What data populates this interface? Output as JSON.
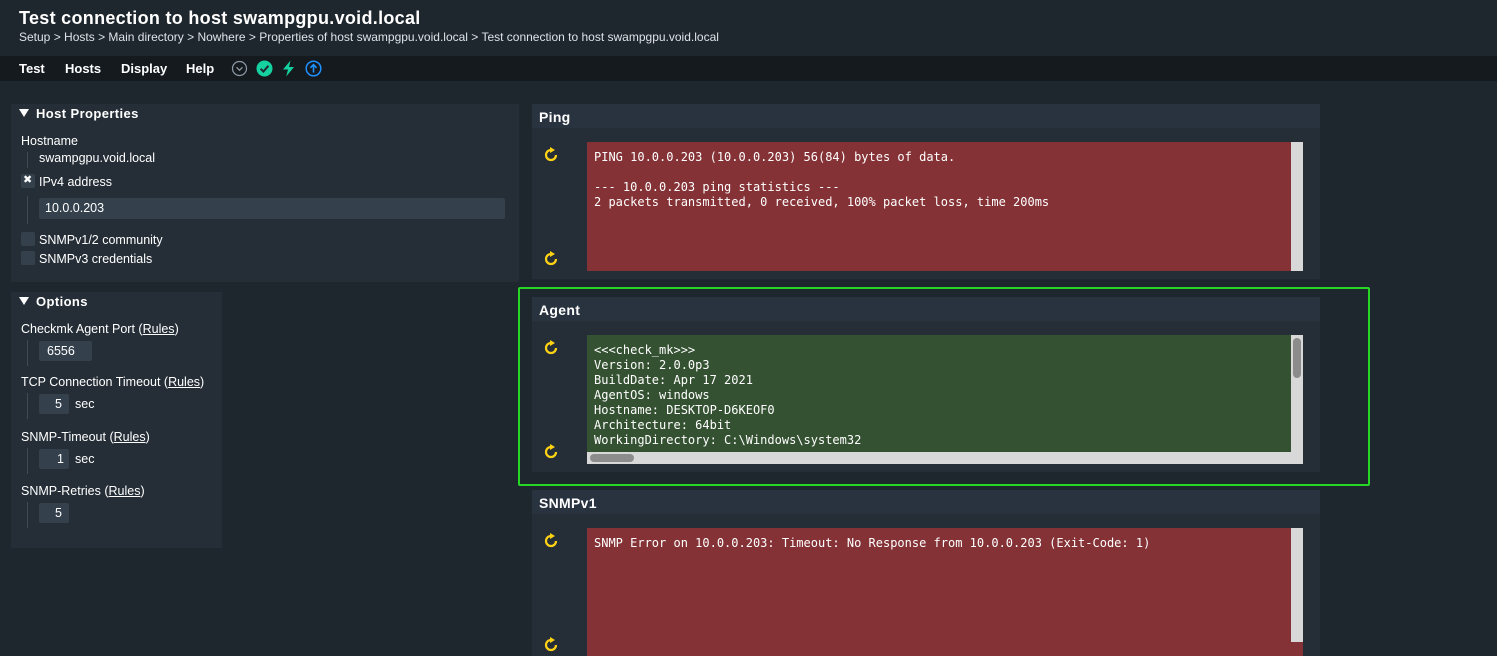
{
  "page": {
    "title": "Test connection to host swampgpu.void.local",
    "breadcrumb": [
      "Setup",
      "Hosts",
      "Main directory",
      "Nowhere",
      "Properties of host swampgpu.void.local",
      "Test connection to host swampgpu.void.local"
    ],
    "breadcrumb_sep": " > "
  },
  "menu": {
    "items": [
      "Test",
      "Hosts",
      "Display",
      "Help"
    ],
    "icons": [
      "chevron-down-icon",
      "check-circle-icon",
      "lightning-icon",
      "upload-icon"
    ]
  },
  "host_properties": {
    "title": "Host Properties",
    "hostname_label": "Hostname",
    "hostname_value": "swampgpu.void.local",
    "ipv4_label": "IPv4 address",
    "ipv4_checked": true,
    "ipv4_value": "10.0.0.203",
    "snmp_community_label": "SNMPv1/2 community",
    "snmp_v3_label": "SNMPv3 credentials"
  },
  "options": {
    "title": "Options",
    "rules_link": "Rules",
    "agent_port_label": "Checkmk Agent Port",
    "agent_port_value": "6556",
    "tcp_timeout_label": "TCP Connection Timeout",
    "tcp_timeout_value": "5",
    "snmp_timeout_label": "SNMP-Timeout",
    "snmp_timeout_value": "1",
    "snmp_retries_label": "SNMP-Retries",
    "snmp_retries_value": "5",
    "unit_sec": "sec"
  },
  "tests": {
    "ping": {
      "title": "Ping",
      "status": "error",
      "output": "PING 10.0.0.203 (10.0.0.203) 56(84) bytes of data.\n\n--- 10.0.0.203 ping statistics ---\n2 packets transmitted, 0 received, 100% packet loss, time 200ms"
    },
    "agent": {
      "title": "Agent",
      "status": "ok",
      "output": "<<<check_mk>>>\nVersion: 2.0.0p3\nBuildDate: Apr 17 2021\nAgentOS: windows\nHostname: DESKTOP-D6KEOF0\nArchitecture: 64bit\nWorkingDirectory: C:\\Windows\\system32"
    },
    "snmpv1": {
      "title": "SNMPv1",
      "status": "error",
      "output": "SNMP Error on 10.0.0.203: Timeout: No Response from 10.0.0.203 (Exit-Code: 1)"
    }
  },
  "colors": {
    "background": "#1e262e",
    "panel": "#252e37",
    "error_bg": "#843236",
    "ok_bg": "#345132",
    "highlight": "#25d625",
    "reload_icon": "#ffd314",
    "check_icon": "#15d1a0",
    "lightning_icon": "#15d1a0",
    "upload_icon": "#1e90ff"
  }
}
